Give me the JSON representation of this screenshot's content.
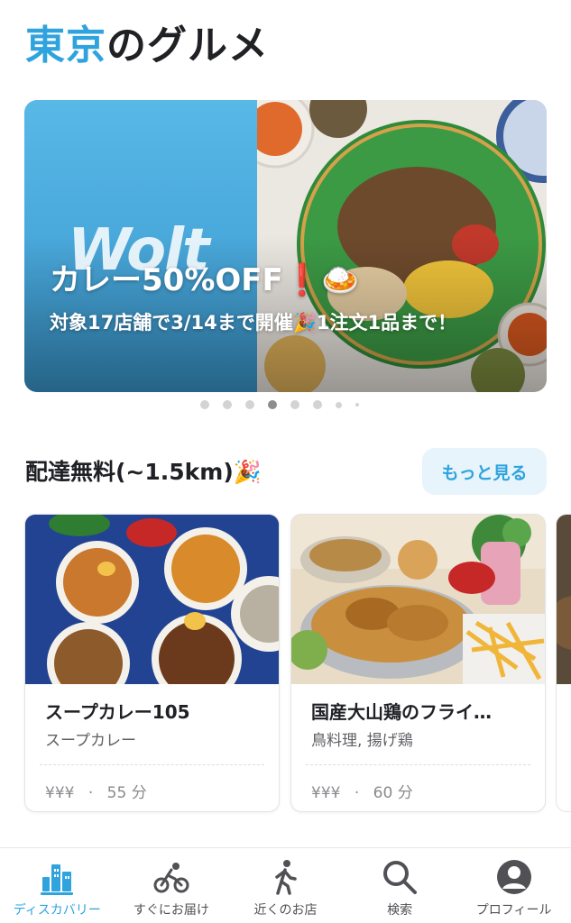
{
  "page": {
    "title_city": "東京",
    "title_rest": "のグルメ"
  },
  "banner": {
    "logo_text": "Wolt",
    "headline": "カレー50%OFF❗️🍛",
    "subtext": "対象17店舗で3/14まで開催🎉1注文1品まで！",
    "accent_color": "#4fb1e2"
  },
  "carousel": {
    "total": 8,
    "active_index": 3
  },
  "section": {
    "title": "配達無料(~1.5km)🎉",
    "more_label": "もっと見る"
  },
  "venues": [
    {
      "name": "スープカレー105",
      "category": "スープカレー",
      "price": "¥¥¥",
      "dot": "·",
      "time": "55 分"
    },
    {
      "name": "国産大山鶏のフライ…",
      "category": "鳥料理, 揚げ鶏",
      "price": "¥¥¥",
      "dot": "·",
      "time": "60 分"
    }
  ],
  "tabs": [
    {
      "label": "ディスカバリー",
      "icon": "discovery-icon",
      "active": true
    },
    {
      "label": "すぐにお届け",
      "icon": "bike-icon",
      "active": false
    },
    {
      "label": "近くのお店",
      "icon": "walk-icon",
      "active": false
    },
    {
      "label": "検索",
      "icon": "search-icon",
      "active": false
    },
    {
      "label": "プロフィール",
      "icon": "profile-icon",
      "active": false
    }
  ],
  "colors": {
    "brand": "#2fa3de",
    "text": "#202125",
    "muted": "#8a8a8f"
  }
}
